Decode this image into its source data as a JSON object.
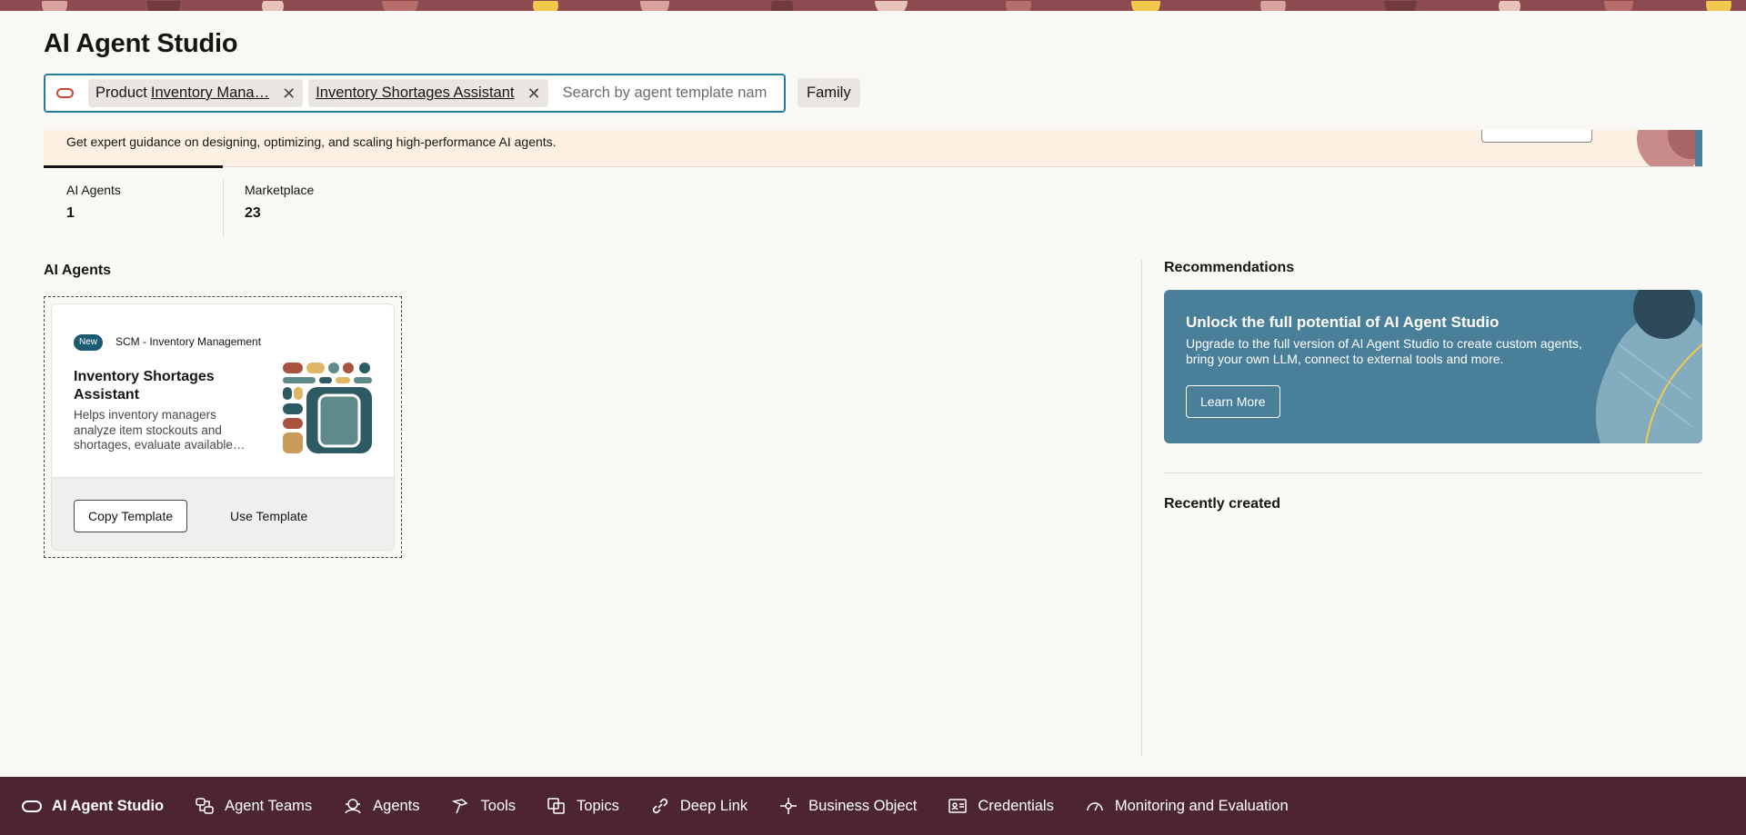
{
  "page": {
    "title": "AI Agent Studio"
  },
  "search": {
    "chips": [
      {
        "label": "Product",
        "value": "Inventory Mana…"
      },
      {
        "label": "",
        "value": "Inventory Shortages Assistant"
      }
    ],
    "placeholder": "Search by agent template nam",
    "family_label": "Family"
  },
  "banner": {
    "text": "Get expert guidance on designing, optimizing, and scaling high-performance AI agents."
  },
  "tabs": [
    {
      "label": "AI Agents",
      "count": "1"
    },
    {
      "label": "Marketplace",
      "count": "23"
    }
  ],
  "section": {
    "agents_title": "AI Agents",
    "recommendations_title": "Recommendations",
    "recently_created_title": "Recently created"
  },
  "agent_card": {
    "badge": "New",
    "category": "SCM - Inventory Management",
    "title": "Inventory Shortages Assistant",
    "description": "Helps inventory managers analyze item stockouts and shortages, evaluate available…",
    "copy_label": "Copy Template",
    "use_label": "Use Template"
  },
  "promo": {
    "title": "Unlock the full potential of AI Agent Studio",
    "description": "Upgrade to the full version of AI Agent Studio to create custom agents, bring your own LLM, connect to external tools and more.",
    "button_label": "Learn More"
  },
  "bottom_nav": {
    "items": [
      {
        "label": "AI Agent Studio",
        "icon": "oracle-icon"
      },
      {
        "label": "Agent Teams",
        "icon": "agent-teams-icon"
      },
      {
        "label": "Agents",
        "icon": "agents-icon"
      },
      {
        "label": "Tools",
        "icon": "hammer-icon"
      },
      {
        "label": "Topics",
        "icon": "topics-icon"
      },
      {
        "label": "Deep Link",
        "icon": "link-icon"
      },
      {
        "label": "Business Object",
        "icon": "business-object-icon"
      },
      {
        "label": "Credentials",
        "icon": "credentials-icon"
      },
      {
        "label": "Monitoring and Evaluation",
        "icon": "gauge-icon"
      }
    ]
  },
  "colors": {
    "accent": "#227e9e",
    "nav_bg": "#4c2530",
    "promo_bg": "#4a7f99",
    "badge_bg": "#1d5a73",
    "banner_bg": "#fcf0e2"
  }
}
